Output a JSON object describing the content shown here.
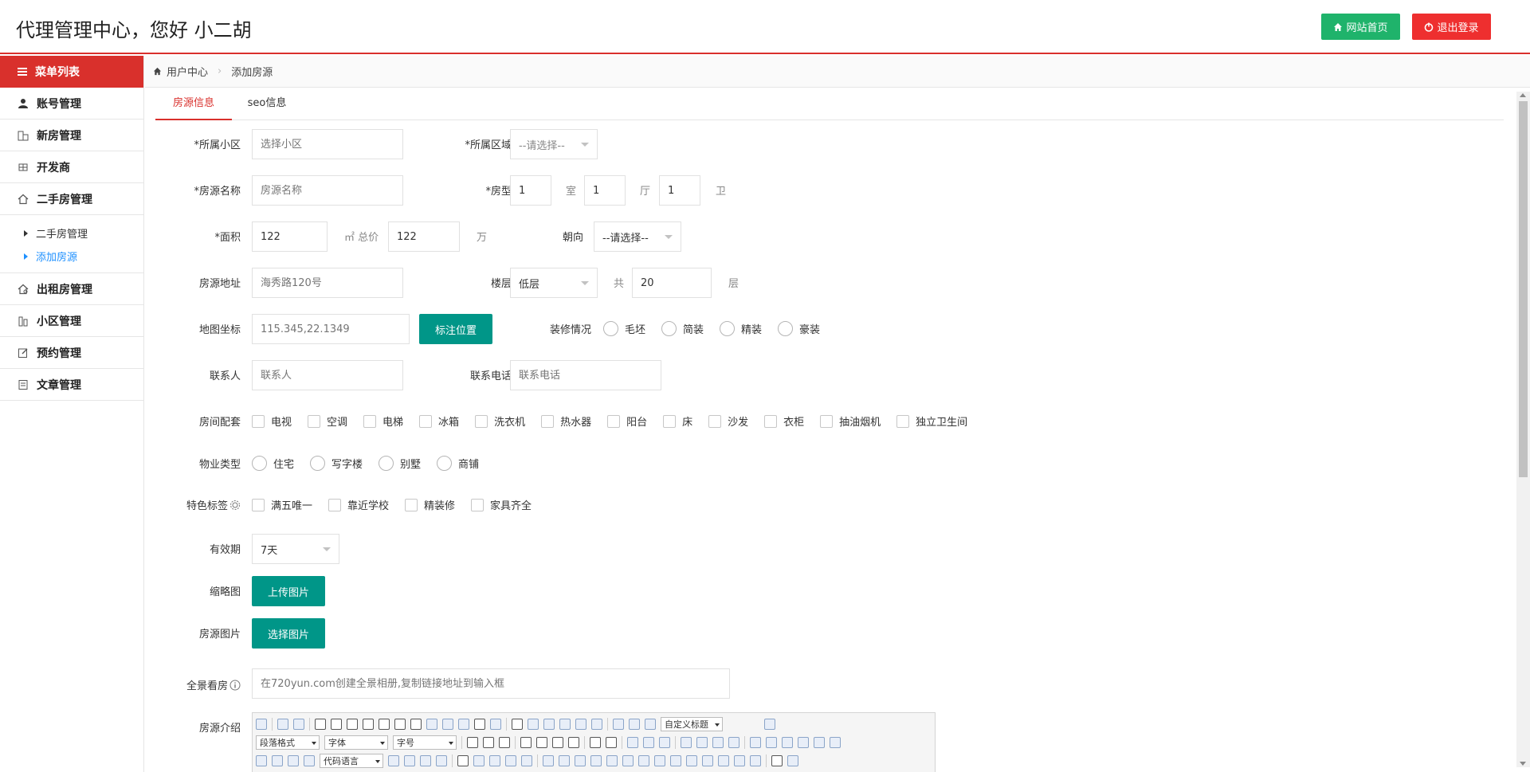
{
  "header": {
    "title": "代理管理中心，您好 小二胡",
    "home_button": "网站首页",
    "logout_button": "退出登录"
  },
  "sidebar": {
    "head": "菜单列表",
    "items": [
      {
        "label": "账号管理",
        "icon": "user-icon"
      },
      {
        "label": "新房管理",
        "icon": "building-icon"
      },
      {
        "label": "开发商",
        "icon": "grid-icon"
      },
      {
        "label": "二手房管理",
        "icon": "home-icon"
      },
      {
        "label": "出租房管理",
        "icon": "house-outline-icon"
      },
      {
        "label": "小区管理",
        "icon": "community-icon"
      },
      {
        "label": "预约管理",
        "icon": "edit-icon"
      },
      {
        "label": "文章管理",
        "icon": "article-icon"
      }
    ],
    "submenu": [
      "二手房管理",
      "添加房源"
    ]
  },
  "breadcrumb": {
    "home": "用户中心",
    "current": "添加房源"
  },
  "tabs": [
    "房源信息",
    "seo信息"
  ],
  "form": {
    "community": {
      "label": "*所属小区",
      "placeholder": "选择小区"
    },
    "area": {
      "label": "*所属区域",
      "value": "--请选择--"
    },
    "name": {
      "label": "*房源名称",
      "placeholder": "房源名称"
    },
    "layout": {
      "label": "*房型",
      "rooms": "1",
      "rooms_unit": "室",
      "halls": "1",
      "halls_unit": "厅",
      "baths": "1",
      "baths_unit": "卫"
    },
    "size": {
      "label": "*面积",
      "value": "122",
      "unit": "㎡ 总价",
      "price": "122",
      "price_unit": "万"
    },
    "orientation": {
      "label": "朝向",
      "value": "--请选择--"
    },
    "address": {
      "label": "房源地址",
      "placeholder": "海秀路120号"
    },
    "floor": {
      "label": "楼层",
      "value": "低层",
      "total_prefix": "共",
      "total": "20",
      "total_unit": "层"
    },
    "coords": {
      "label": "地图坐标",
      "placeholder": "115.345,22.1349",
      "button": "标注位置"
    },
    "decoration": {
      "label": "装修情况",
      "options": [
        "毛坯",
        "简装",
        "精装",
        "豪装"
      ]
    },
    "contact": {
      "label": "联系人",
      "placeholder": "联系人"
    },
    "phone": {
      "label": "联系电话",
      "placeholder": "联系电话"
    },
    "facilities": {
      "label": "房间配套",
      "options": [
        "电视",
        "空调",
        "电梯",
        "冰箱",
        "洗衣机",
        "热水器",
        "阳台",
        "床",
        "沙发",
        "衣柜",
        "抽油烟机",
        "独立卫生间"
      ]
    },
    "property_type": {
      "label": "物业类型",
      "options": [
        "住宅",
        "写字楼",
        "别墅",
        "商铺"
      ]
    },
    "tags": {
      "label": "特色标签",
      "options": [
        "满五唯一",
        "靠近学校",
        "精装修",
        "家具齐全"
      ]
    },
    "validity": {
      "label": "有效期",
      "value": "7天"
    },
    "thumbnail": {
      "label": "缩略图",
      "button": "上传图片"
    },
    "images": {
      "label": "房源图片",
      "button": "选择图片"
    },
    "panorama": {
      "label": "全景看房",
      "placeholder": "在720yun.com创建全景相册,复制链接地址到输入框"
    },
    "intro": {
      "label": "房源介绍"
    }
  },
  "editor": {
    "custom_title": "自定义标题",
    "paragraph": "段落格式",
    "font": "字体",
    "size": "字号",
    "code": "代码语言"
  },
  "colors": {
    "accent": "#d9302c",
    "green": "#1fb36b",
    "teal": "#009688",
    "red": "#ee2f2f",
    "link": "#1e90ff"
  }
}
